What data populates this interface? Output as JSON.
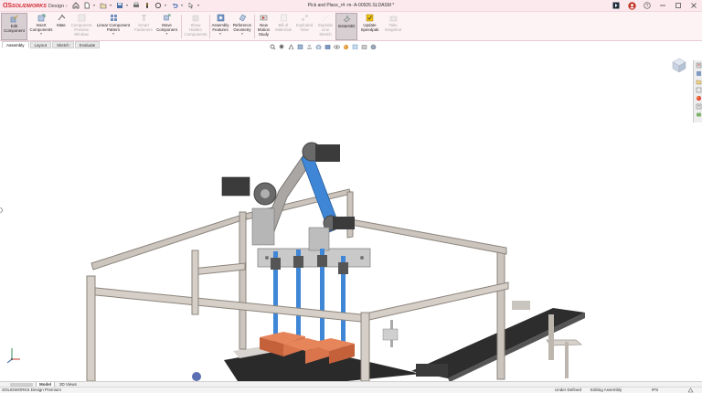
{
  "app": {
    "brand": "SOLIDWORKS",
    "product": "Design",
    "document_title": "Pick and Place_r4 -m- A-00926.SLDASM *"
  },
  "ribbon": {
    "buttons": [
      {
        "name": "edit-component-button",
        "label": "Edit\nComponent",
        "disabled": false,
        "active": true
      },
      {
        "name": "insert-components-button",
        "label": "Insert\nComponents",
        "disabled": false
      },
      {
        "name": "mate-button",
        "label": "Mate",
        "disabled": false
      },
      {
        "name": "component-preview-window-button",
        "label": "Component\nPreview\nWindow",
        "disabled": true
      },
      {
        "name": "linear-component-pattern-button",
        "label": "Linear Component\nPattern",
        "disabled": false
      },
      {
        "name": "smart-fasteners-button",
        "label": "Smart\nFasteners",
        "disabled": true
      },
      {
        "name": "move-component-button",
        "label": "Move\nComponent",
        "disabled": false
      },
      {
        "name": "show-hidden-components-button",
        "label": "Show\nHidden\nComponents",
        "disabled": true
      },
      {
        "name": "assembly-features-button",
        "label": "Assembly\nFeatures",
        "disabled": false
      },
      {
        "name": "reference-geometry-button",
        "label": "Reference\nGeometry",
        "disabled": false
      },
      {
        "name": "new-motion-study-button",
        "label": "New\nMotion\nStudy",
        "disabled": false
      },
      {
        "name": "bill-of-materials-button",
        "label": "Bill of\nMaterials",
        "disabled": true
      },
      {
        "name": "exploded-view-button",
        "label": "Exploded\nView",
        "disabled": true
      },
      {
        "name": "explode-line-sketch-button",
        "label": "Explode\nLine\nSketch",
        "disabled": true
      },
      {
        "name": "instant3d-button",
        "label": "Instant3D",
        "disabled": false,
        "active": true
      },
      {
        "name": "update-speedpak-button",
        "label": "Update\nSpeedpak",
        "disabled": false
      },
      {
        "name": "take-snapshot-button",
        "label": "Take\nSnapshot",
        "disabled": true
      }
    ]
  },
  "tabs": [
    {
      "label": "Assembly",
      "active": true
    },
    {
      "label": "Layout",
      "active": false
    },
    {
      "label": "Sketch",
      "active": false
    },
    {
      "label": "Evaluate",
      "active": false
    }
  ],
  "bottom_tabs": {
    "model": "Model",
    "views3d": "3D Views"
  },
  "status": {
    "product": "SOLIDWORKS Design Premium",
    "under_defined": "Under Defined",
    "editing": "Editing Assembly",
    "units": "IPS"
  },
  "icons": {
    "home": "home-icon",
    "new": "new-document-icon",
    "open": "open-icon",
    "save": "save-icon",
    "print": "print-icon",
    "rebuild": "rebuild-icon",
    "undo": "undo-icon",
    "options": "options-icon",
    "search": "search-icon",
    "help": "help-icon",
    "user": "user-icon",
    "minimize": "minimize-icon",
    "maximize": "maximize-icon",
    "close": "close-icon"
  },
  "colors": {
    "accent": "#d22630",
    "titlebar": "#fbe9ee",
    "ribbon": "#fdf3f5",
    "arm_blue": "#3f86d6",
    "frame": "#9a938d",
    "boxes": "#d9744c"
  }
}
